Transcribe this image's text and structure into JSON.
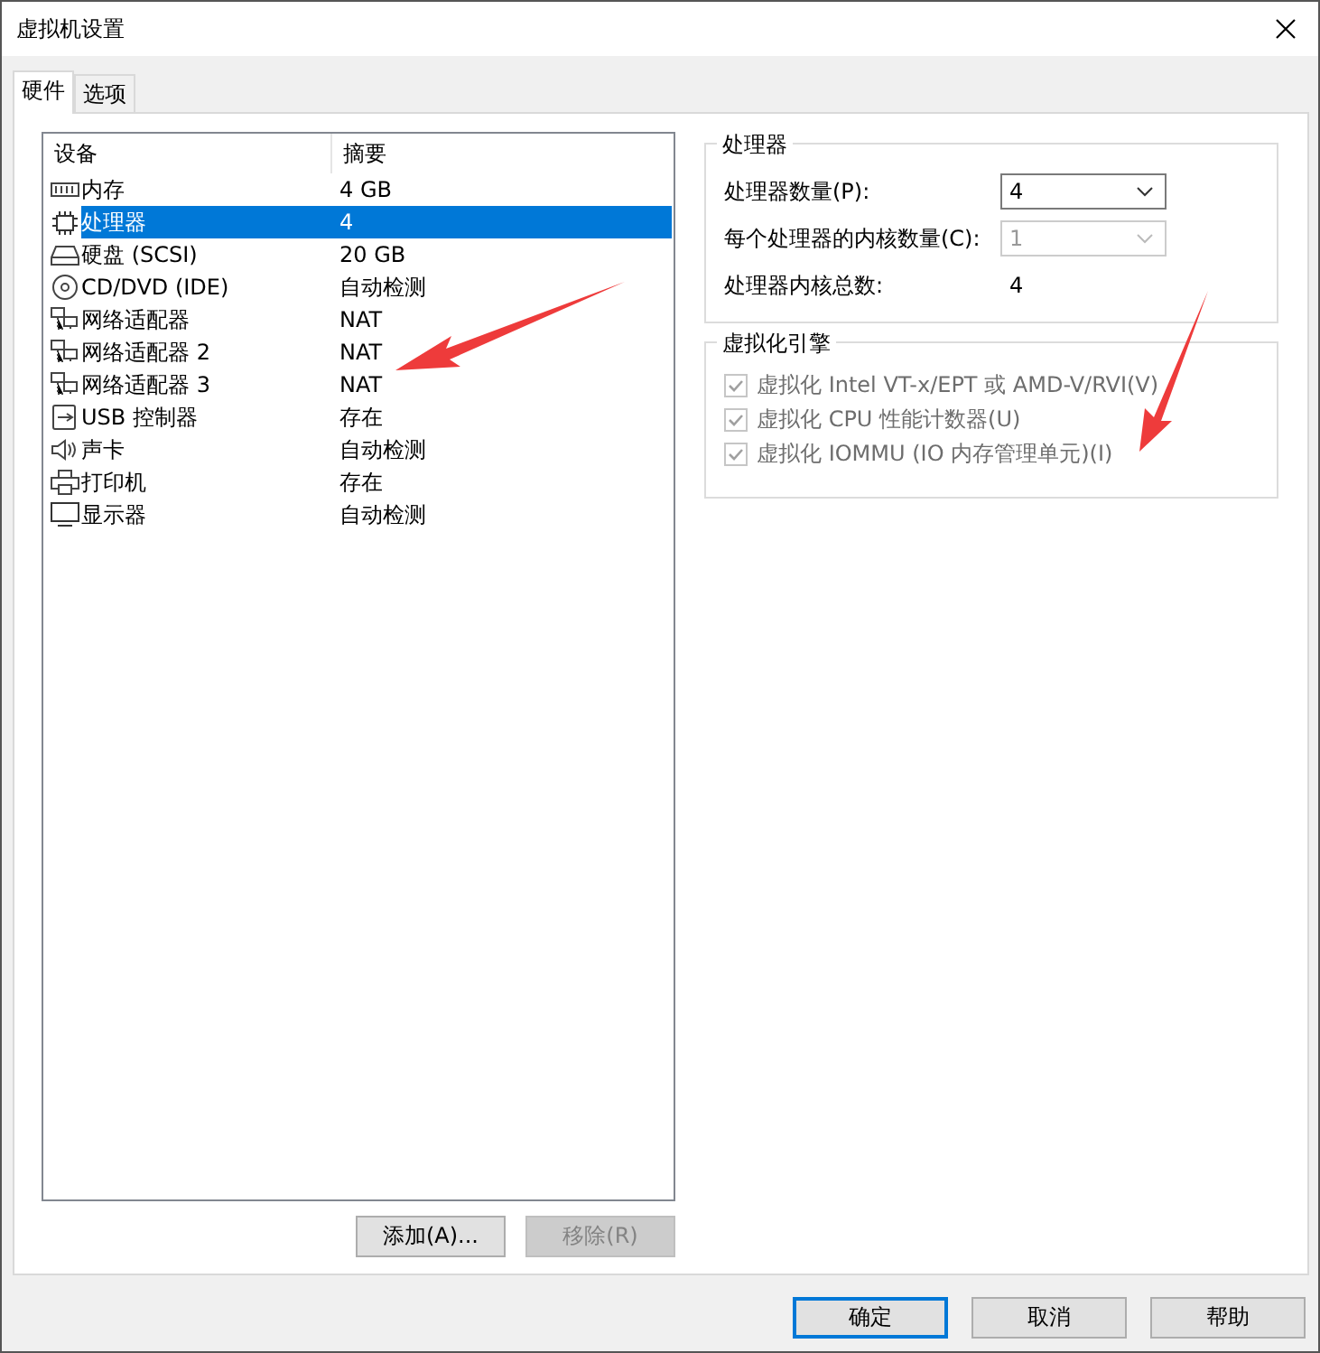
{
  "window": {
    "title": "虚拟机设置"
  },
  "tabs": [
    {
      "label": "硬件",
      "selected": true
    },
    {
      "label": "选项",
      "selected": false
    }
  ],
  "device_list": {
    "columns": [
      "设备",
      "摘要"
    ],
    "rows": [
      {
        "kind": "memory",
        "device": "内存",
        "summary": "4 GB",
        "selected": false
      },
      {
        "kind": "cpu",
        "device": "处理器",
        "summary": "4",
        "selected": true
      },
      {
        "kind": "disk",
        "device": "硬盘 (SCSI)",
        "summary": "20 GB",
        "selected": false
      },
      {
        "kind": "cd",
        "device": "CD/DVD (IDE)",
        "summary": "自动检测",
        "selected": false
      },
      {
        "kind": "network",
        "device": "网络适配器",
        "summary": "NAT",
        "selected": false
      },
      {
        "kind": "network",
        "device": "网络适配器 2",
        "summary": "NAT",
        "selected": false
      },
      {
        "kind": "network",
        "device": "网络适配器 3",
        "summary": "NAT",
        "selected": false
      },
      {
        "kind": "usb",
        "device": "USB 控制器",
        "summary": "存在",
        "selected": false
      },
      {
        "kind": "sound",
        "device": "声卡",
        "summary": "自动检测",
        "selected": false
      },
      {
        "kind": "printer",
        "device": "打印机",
        "summary": "存在",
        "selected": false
      },
      {
        "kind": "display",
        "device": "显示器",
        "summary": "自动检测",
        "selected": false
      }
    ]
  },
  "list_buttons": [
    {
      "label": "添加(A)...",
      "disabled": false
    },
    {
      "label": "移除(R)",
      "disabled": true
    }
  ],
  "processor_group": {
    "title": "处理器",
    "fields": [
      {
        "label": "处理器数量(P):",
        "value": "4",
        "disabled": false
      },
      {
        "label": "每个处理器的内核数量(C):",
        "value": "1",
        "disabled": true
      }
    ],
    "total": {
      "label": "处理器内核总数:",
      "value": "4"
    }
  },
  "virtualization_group": {
    "title": "虚拟化引擎",
    "options": [
      {
        "label": "虚拟化 Intel VT-x/EPT 或 AMD-V/RVI(V)",
        "checked": true,
        "disabled": true
      },
      {
        "label": "虚拟化 CPU 性能计数器(U)",
        "checked": true,
        "disabled": true
      },
      {
        "label": "虚拟化 IOMMU (IO 内存管理单元)(I)",
        "checked": true,
        "disabled": true
      }
    ]
  },
  "dialog_buttons": [
    {
      "label": "确定",
      "default": true
    },
    {
      "label": "取消",
      "default": false
    },
    {
      "label": "帮助",
      "default": false
    }
  ]
}
